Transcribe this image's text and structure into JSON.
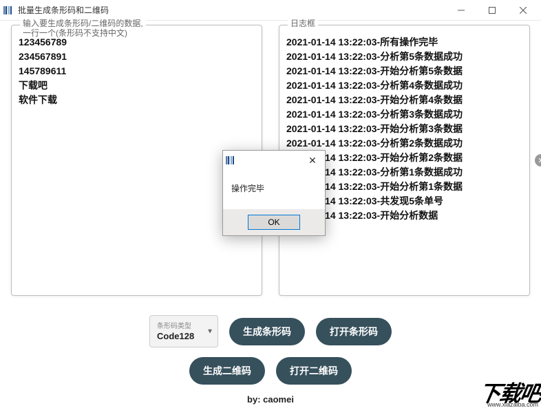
{
  "window": {
    "title": "批量生成条形码和二维码"
  },
  "leftPanel": {
    "label": "输入要生成条形码/二维码的数据,\n一行一个(条形码不支持中文)",
    "lines": [
      "123456789",
      "234567891",
      "145789611",
      "下载吧",
      "软件下载"
    ]
  },
  "rightPanel": {
    "label": "日志框",
    "lines": [
      "2021-01-14 13:22:03-所有操作完毕",
      "2021-01-14 13:22:03-分析第5条数据成功",
      "2021-01-14 13:22:03-开始分析第5条数据",
      "2021-01-14 13:22:03-分析第4条数据成功",
      "2021-01-14 13:22:03-开始分析第4条数据",
      "2021-01-14 13:22:03-分析第3条数据成功",
      "2021-01-14 13:22:03-开始分析第3条数据",
      "2021-01-14 13:22:03-分析第2条数据成功",
      "2021-01-14 13:22:03-开始分析第2条数据",
      "2021-01-14 13:22:03-分析第1条数据成功",
      "2021-01-14 13:22:03-开始分析第1条数据",
      "2021-01-14 13:22:03-共发现5条单号",
      "2021-01-14 13:22:03-开始分析数据"
    ]
  },
  "select": {
    "label": "条形码类型",
    "value": "Code128"
  },
  "buttons": {
    "genBarcode": "生成条形码",
    "openBarcode": "打开条形码",
    "genQR": "生成二维码",
    "openQR": "打开二维码"
  },
  "footer": "by: caomei",
  "dialog": {
    "message": "操作完毕",
    "ok": "OK"
  },
  "watermark": {
    "text": "下载吧",
    "url": "www.xiazaiba.com"
  }
}
